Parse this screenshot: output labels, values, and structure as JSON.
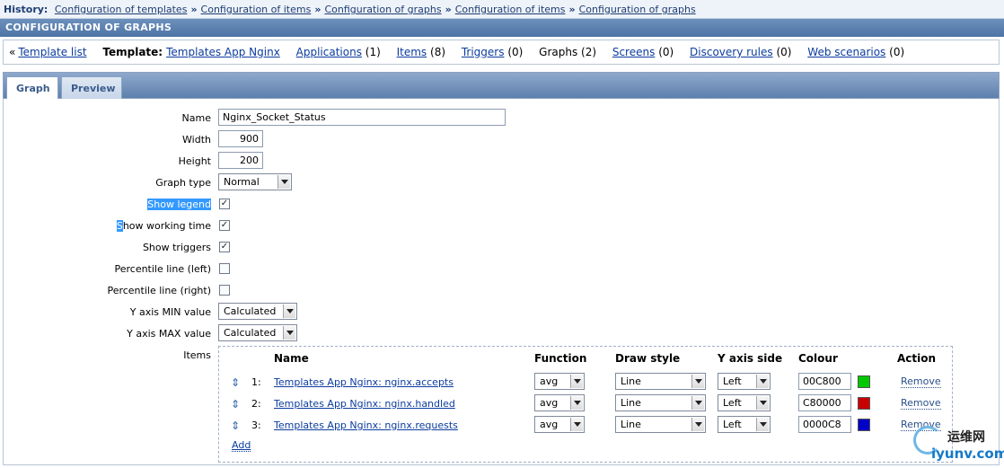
{
  "history": {
    "label": "History:",
    "crumbs": [
      "Configuration of templates",
      "Configuration of items",
      "Configuration of graphs",
      "Configuration of items",
      "Configuration of graphs"
    ],
    "separator": "»"
  },
  "page_title": "CONFIGURATION OF GRAPHS",
  "nav": {
    "back_marker": "«",
    "template_list": "Template list",
    "template_label": "Template:",
    "template_name": "Templates App Nginx",
    "applications": "Applications",
    "applications_count": "(1)",
    "items": "Items",
    "items_count": "(8)",
    "triggers": "Triggers",
    "triggers_count": "(0)",
    "graphs": "Graphs (2)",
    "screens": "Screens",
    "screens_count": "(0)",
    "discovery": "Discovery rules",
    "discovery_count": "(0)",
    "web": "Web scenarios",
    "web_count": "(0)"
  },
  "tabs": {
    "graph": "Graph",
    "preview": "Preview"
  },
  "form": {
    "name_label": "Name",
    "name_value": "Nginx_Socket_Status",
    "width_label": "Width",
    "width_value": "900",
    "height_label": "Height",
    "height_value": "200",
    "graph_type_label": "Graph type",
    "graph_type_value": "Normal",
    "show_legend_label": "Show legend",
    "show_legend": true,
    "show_working_time_label_sel": "S",
    "show_working_time_label_rest": "how working time",
    "show_working_time": true,
    "show_triggers_label": "Show triggers",
    "show_triggers": true,
    "percentile_left_label": "Percentile line (left)",
    "percentile_left": false,
    "percentile_right_label": "Percentile line (right)",
    "percentile_right": false,
    "ymin_label": "Y axis MIN value",
    "ymin_value": "Calculated",
    "ymax_label": "Y axis MAX value",
    "ymax_value": "Calculated",
    "items_label": "Items"
  },
  "items_table": {
    "headers": {
      "name": "Name",
      "function": "Function",
      "draw_style": "Draw style",
      "y_axis_side": "Y axis side",
      "colour": "Colour",
      "action": "Action"
    },
    "rows": [
      {
        "index": "1:",
        "name": "Templates App Nginx: nginx.accepts",
        "function": "avg",
        "draw_style": "Line",
        "y_axis_side": "Left",
        "colour": "00C800",
        "swatch": "#00C800",
        "action": "Remove"
      },
      {
        "index": "2:",
        "name": "Templates App Nginx: nginx.handled",
        "function": "avg",
        "draw_style": "Line",
        "y_axis_side": "Left",
        "colour": "C80000",
        "swatch": "#C80000",
        "action": "Remove"
      },
      {
        "index": "3:",
        "name": "Templates App Nginx: nginx.requests",
        "function": "avg",
        "draw_style": "Line",
        "y_axis_side": "Left",
        "colour": "0000C8",
        "swatch": "#0000C8",
        "action": "Remove"
      }
    ],
    "add": "Add"
  },
  "watermark": {
    "cn": "运维网",
    "url": "iyunv.com"
  }
}
